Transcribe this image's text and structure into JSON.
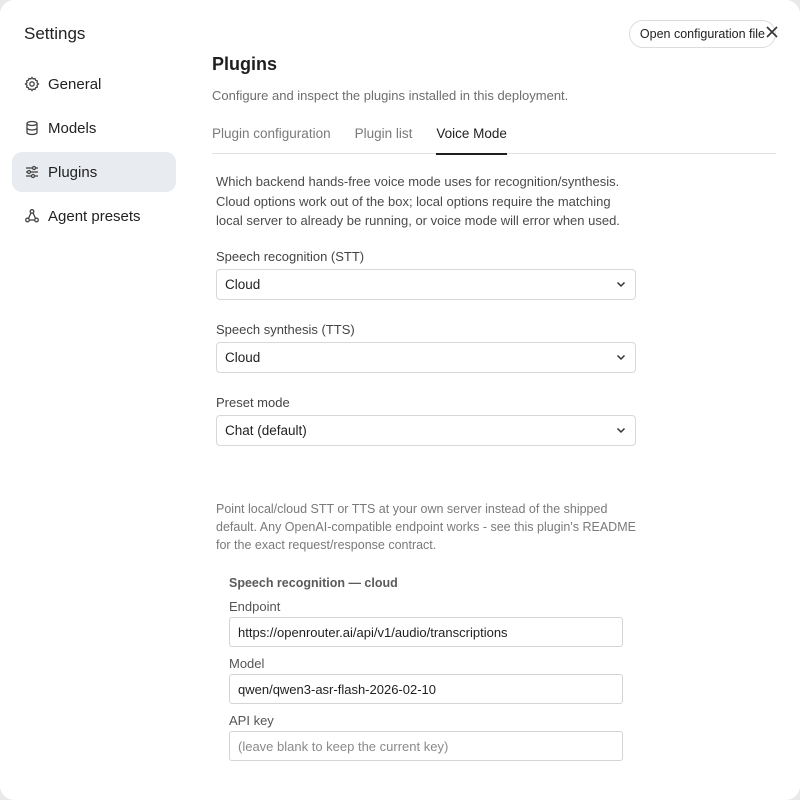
{
  "sidebar": {
    "title": "Settings",
    "items": [
      {
        "label": "General",
        "icon": "gear-icon",
        "active": false
      },
      {
        "label": "Models",
        "icon": "database-icon",
        "active": false
      },
      {
        "label": "Plugins",
        "icon": "sliders-icon",
        "active": true
      },
      {
        "label": "Agent presets",
        "icon": "share-nodes-icon",
        "active": false
      }
    ]
  },
  "header": {
    "open_config_label": "Open configuration file",
    "close_icon": "close-icon"
  },
  "page": {
    "title": "Plugins",
    "subtitle": "Configure and inspect the plugins installed in this deployment.",
    "tabs": [
      {
        "label": "Plugin configuration",
        "active": false
      },
      {
        "label": "Plugin list",
        "active": false
      },
      {
        "label": "Voice Mode",
        "active": true
      }
    ]
  },
  "voice_mode": {
    "description": "Which backend hands-free voice mode uses for recognition/synthesis. Cloud options work out of the box; local options require the matching local server to already be running, or voice mode will error when used.",
    "stt": {
      "label": "Speech recognition (STT)",
      "value": "Cloud"
    },
    "tts": {
      "label": "Speech synthesis (TTS)",
      "value": "Cloud"
    },
    "preset": {
      "label": "Preset mode",
      "value": "Chat (default)"
    },
    "endpoint_description": "Point local/cloud STT or TTS at your own server instead of the shipped default. Any OpenAI-compatible endpoint works - see this plugin's README for the exact request/response contract.",
    "stt_cloud": {
      "heading": "Speech recognition — cloud",
      "endpoint_label": "Endpoint",
      "endpoint_value": "https://openrouter.ai/api/v1/audio/transcriptions",
      "model_label": "Model",
      "model_value": "qwen/qwen3-asr-flash-2026-02-10",
      "api_key_label": "API key",
      "api_key_placeholder": "(leave blank to keep the current key)",
      "api_key_value": ""
    }
  }
}
